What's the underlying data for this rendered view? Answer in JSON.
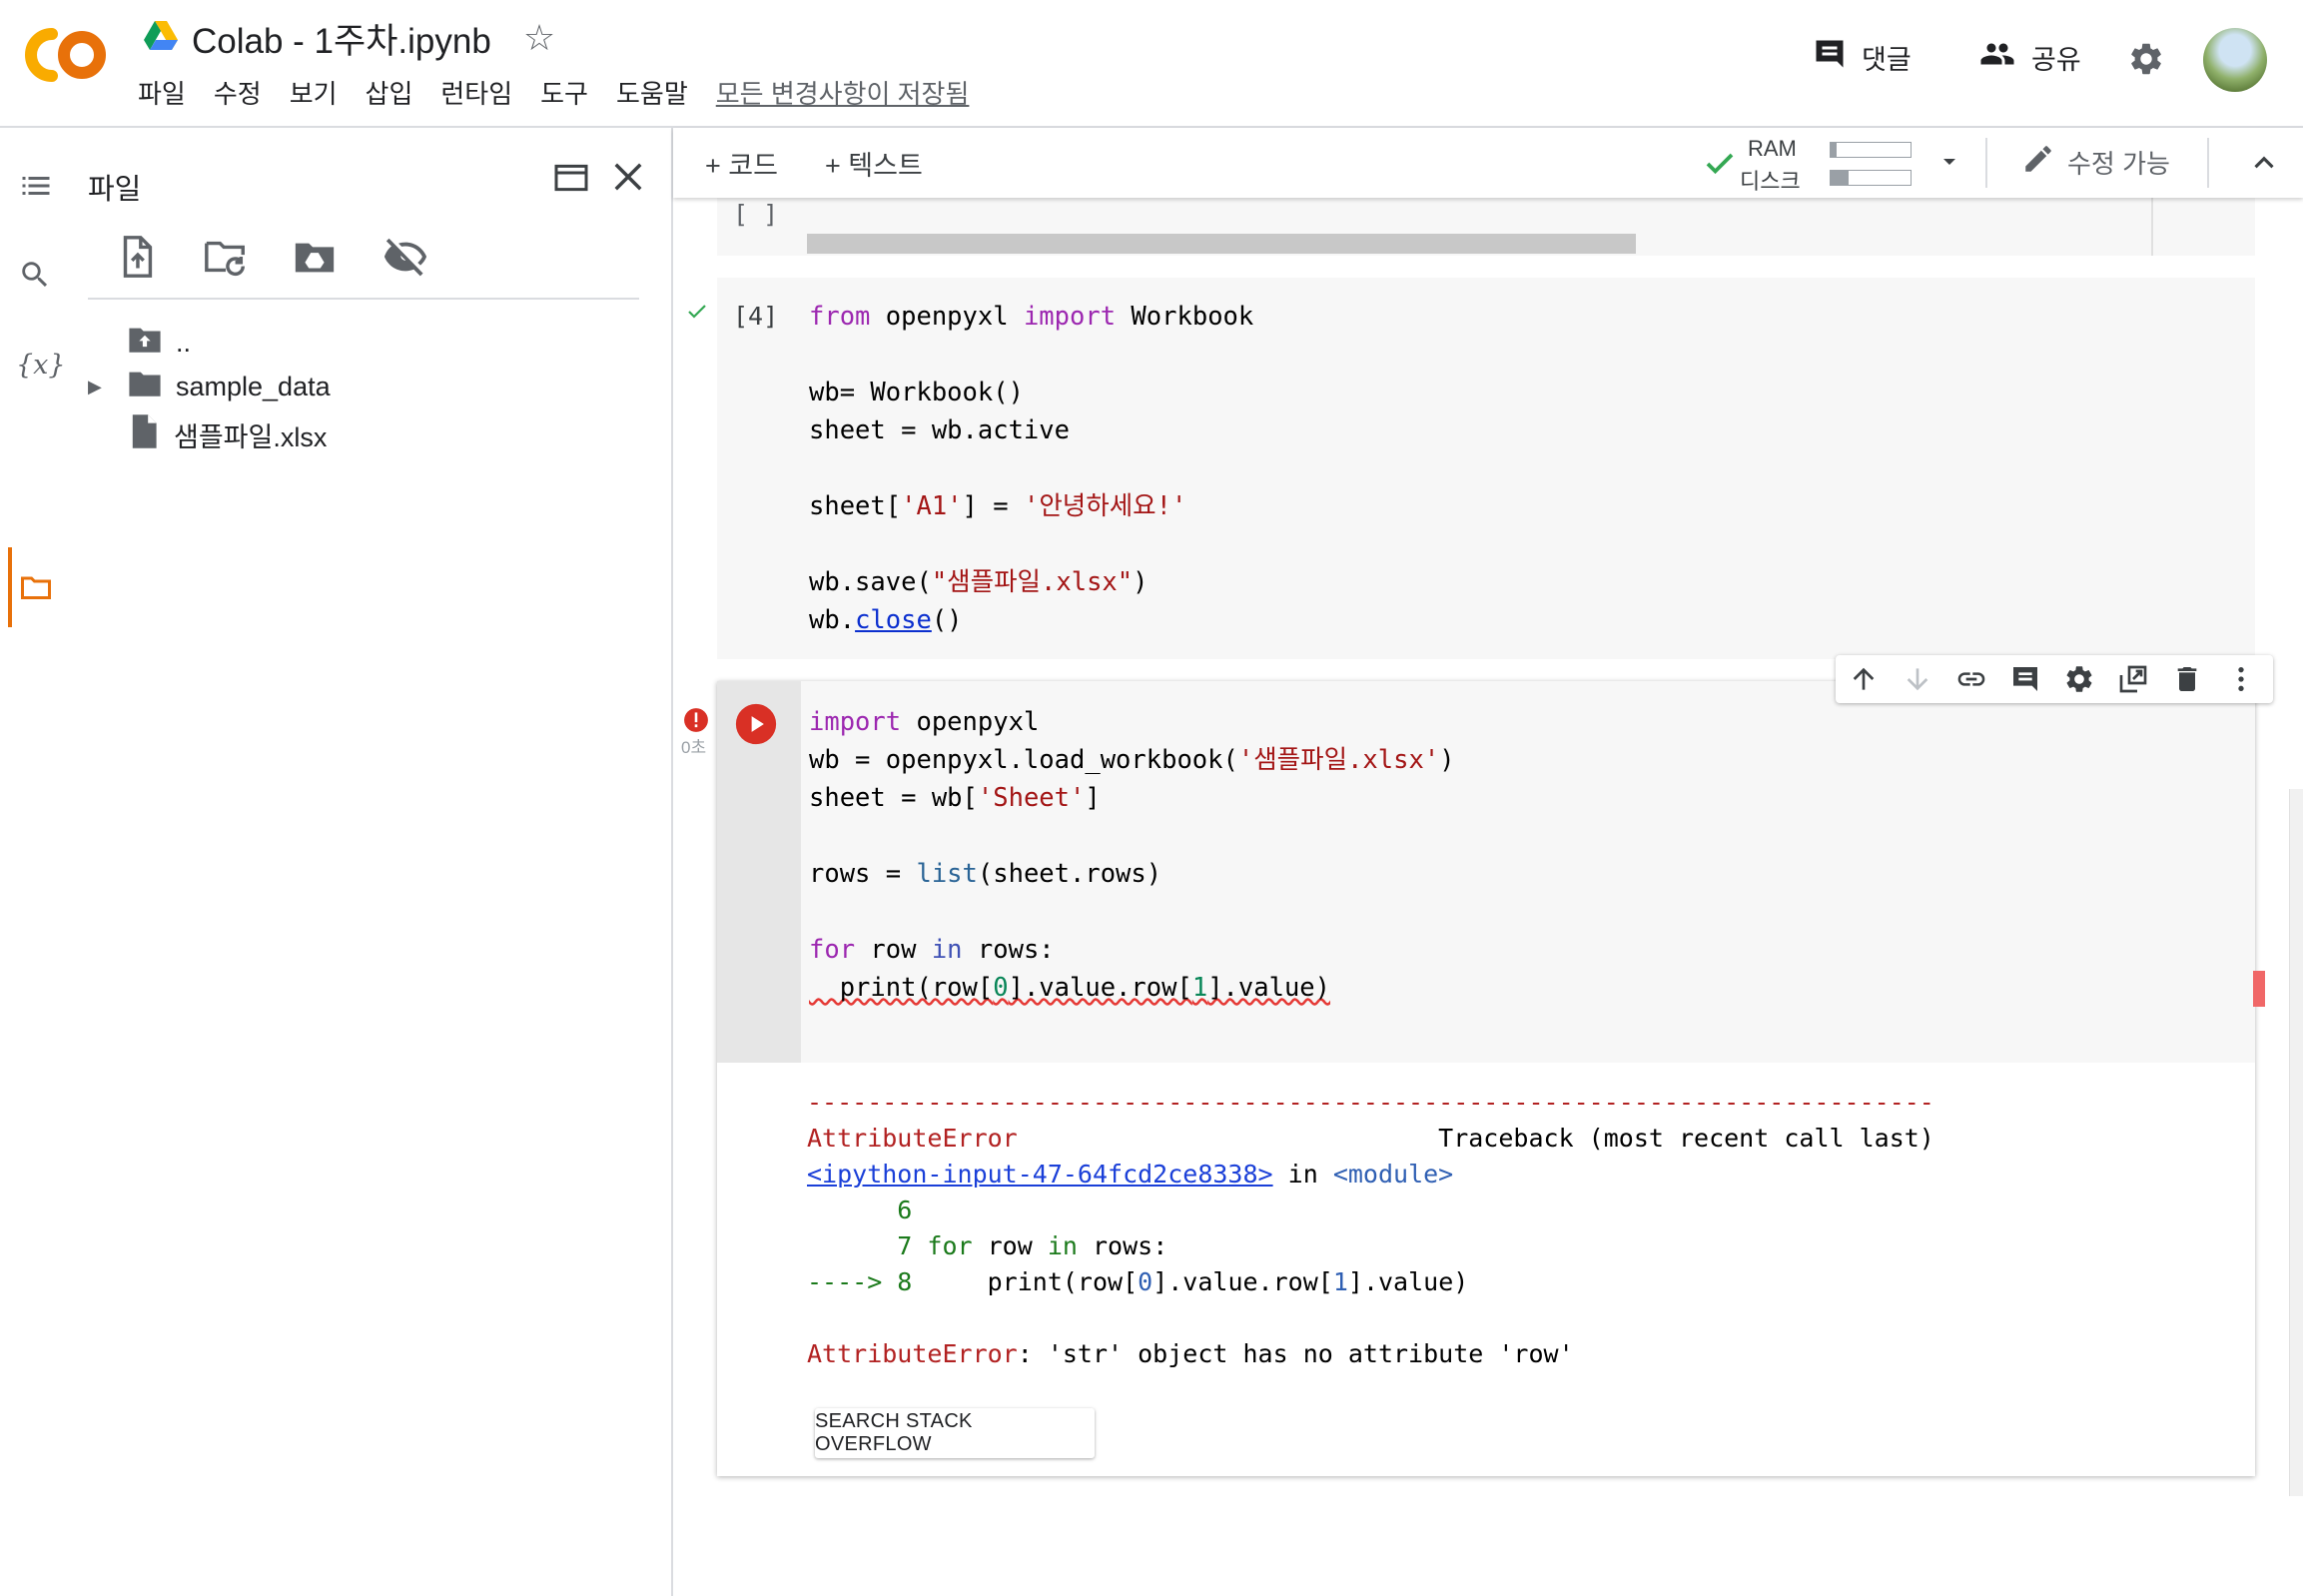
{
  "header": {
    "logo_text": "CO",
    "title": "Colab - 1주차.ipynb",
    "menu": [
      "파일",
      "수정",
      "보기",
      "삽입",
      "런타임",
      "도구",
      "도움말"
    ],
    "saved_status": "모든 변경사항이 저장됨",
    "comment_label": "댓글",
    "share_label": "공유"
  },
  "filepanel": {
    "title": "파일",
    "items": [
      {
        "name": ".."
      },
      {
        "name": "sample_data"
      },
      {
        "name": "샘플파일.xlsx"
      }
    ]
  },
  "toolbar": {
    "add_code": "+ 코드",
    "add_text": "+ 텍스트",
    "ram_label": "RAM",
    "disk_label": "디스크",
    "ram_usage": 0.08,
    "disk_usage": 0.22,
    "edit_mode": "수정 가능"
  },
  "cells": {
    "cell0_prompt": "[ ]",
    "cell1_prompt": "[4]",
    "cell1_lines": [
      [
        "from",
        " openpyxl ",
        "import",
        " Workbook"
      ],
      [
        "wb= Workbook()"
      ],
      [
        "sheet = wb.active"
      ],
      [
        "sheet[",
        "'A1'",
        "] = ",
        "'안녕하세요!'"
      ],
      [
        "wb.save(",
        "\"샘플파일.xlsx\"",
        ")"
      ],
      [
        "wb.",
        "close",
        "()"
      ]
    ],
    "cell2_exec_time": "0초",
    "cell2_lines": [
      [
        "import",
        " openpyxl"
      ],
      [
        "wb = openpyxl.load_workbook(",
        "'샘플파일.xlsx'",
        ")"
      ],
      [
        "sheet = wb[",
        "'Sheet'",
        "]"
      ],
      [
        "rows = ",
        "list",
        "(sheet.rows)"
      ],
      [
        "for",
        " row ",
        "in",
        " rows:"
      ],
      [
        "  print(row[",
        "0",
        "].value.row[",
        "1",
        "].value)"
      ]
    ]
  },
  "output": {
    "dashes": "---------------------------------------------------------------------------",
    "error_name": "AttributeError",
    "traceback_label": "Traceback (most recent call last)",
    "input_link": "<ipython-input-47-64fcd2ce8338>",
    "in_text": " in ",
    "module_text": "<module>",
    "tb_lines": [
      [
        "      6",
        ""
      ],
      [
        "      7 ",
        "for",
        " row ",
        "in",
        " rows:"
      ],
      [
        "----> 8",
        "     print(row[",
        "0",
        "].value.row[",
        "1",
        "].value)"
      ]
    ],
    "error_message": ": 'str' object has no attribute 'row'",
    "search_button": "SEARCH STACK OVERFLOW"
  },
  "colors": {
    "accent_orange": "#e8710a",
    "keyword": "#9c27b0",
    "string": "#a31515",
    "error": "#b22222",
    "run_button": "#d93025"
  }
}
